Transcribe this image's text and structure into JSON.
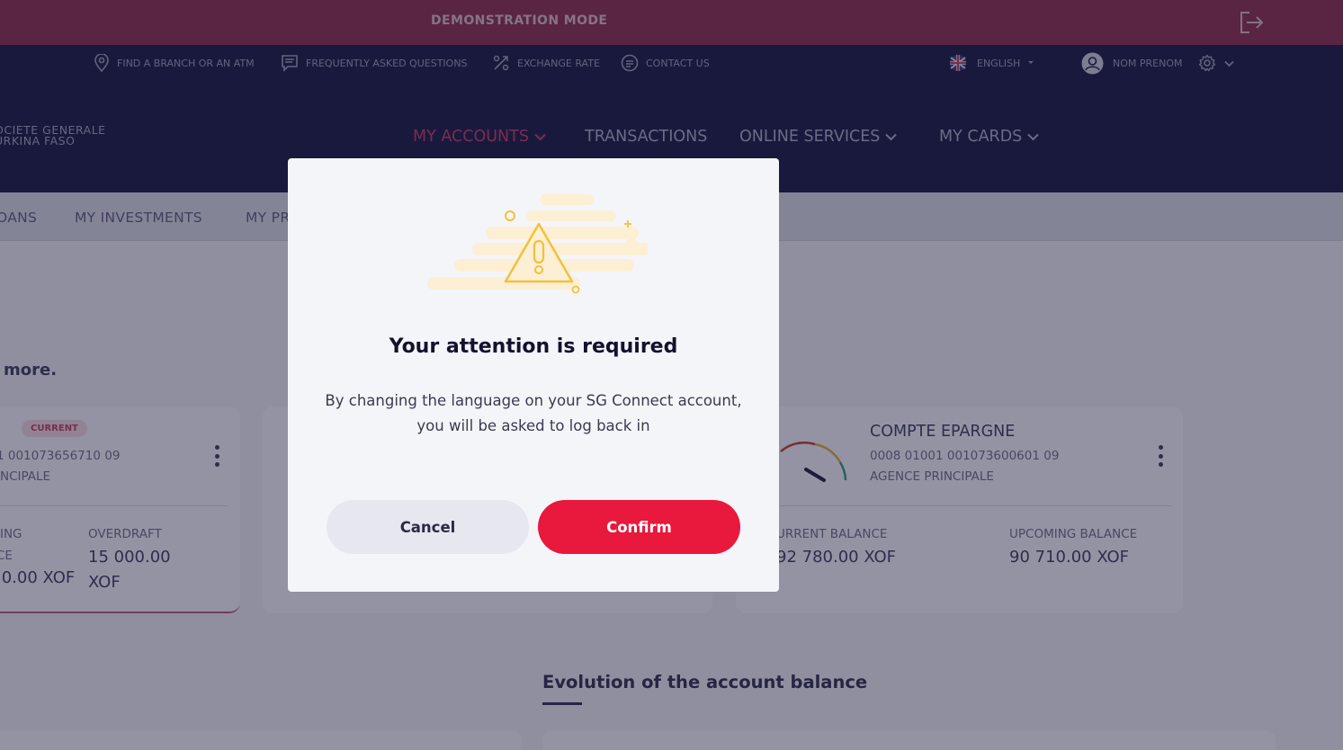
{
  "demo_banner": {
    "label": "DEMONSTRATION MODE"
  },
  "utility_bar": {
    "links": [
      "FIND A BRANCH OR AN ATM",
      "FREQUENTLY ASKED QUESTIONS",
      "EXCHANGE RATE",
      "CONTACT US"
    ],
    "language": "ENGLISH",
    "user_name": "NOM PRENOM"
  },
  "brand": {
    "line1": "OCIETE GENERALE",
    "line2": "URKINA FASO"
  },
  "main_nav": {
    "items": [
      "MY ACCOUNTS",
      "TRANSACTIONS",
      "ONLINE SERVICES",
      "MY CARDS"
    ],
    "active": "MY ACCOUNTS"
  },
  "sub_nav": {
    "items": [
      "OANS",
      "MY INVESTMENTS",
      "MY PR"
    ]
  },
  "intro_text": "more.",
  "accounts": [
    {
      "badge": "CURRENT",
      "number": "1 001073656710 09",
      "agency": "INCIPALE",
      "balance_label_line1": "IING",
      "balance_label_line2": "CE",
      "balance_value": ".0.00 XOF",
      "overdraft_label": "OVERDRAFT",
      "overdraft_value_line1": "15 000.00",
      "overdraft_value_line2": "XOF"
    },
    {
      "title": "COMPTE EPARGNE",
      "number": "0008 01001 001073600601 09",
      "agency": "AGENCE PRINCIPALE",
      "current_label": "URRENT BALANCE",
      "current_value": "92 780.00 XOF",
      "upcoming_label": "UPCOMING BALANCE",
      "upcoming_value": "90 710.00 XOF"
    }
  ],
  "section": {
    "title": "Evolution of the account balance"
  },
  "modal": {
    "title": "Your attention is required",
    "message": "By changing the language on your SG Connect account, you will be asked to log back in",
    "cancel_label": "Cancel",
    "confirm_label": "Confirm"
  },
  "colors": {
    "accent": "#e8193d",
    "navy": "#15153e",
    "demo_bar": "#8a2b4a",
    "warning": "#f2c13a"
  }
}
